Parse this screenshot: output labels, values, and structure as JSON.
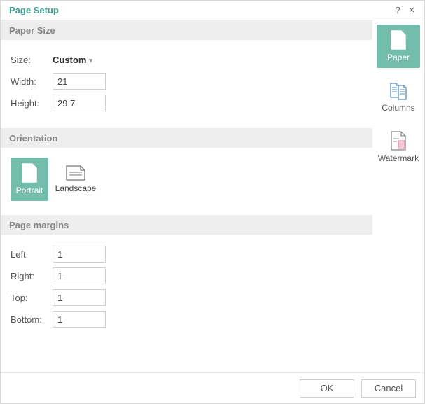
{
  "dialog": {
    "title": "Page Setup",
    "help_glyph": "?",
    "close_glyph": "✕"
  },
  "sections": {
    "paper_size": {
      "header": "Paper Size",
      "size_label": "Size:",
      "size_value": "Custom",
      "width_label": "Width:",
      "width_value": "21",
      "height_label": "Height:",
      "height_value": "29.7"
    },
    "orientation": {
      "header": "Orientation",
      "portrait_label": "Portrait",
      "landscape_label": "Landscape"
    },
    "margins": {
      "header": "Page margins",
      "left_label": "Left:",
      "left_value": "1",
      "right_label": "Right:",
      "right_value": "1",
      "top_label": "Top:",
      "top_value": "1",
      "bottom_label": "Bottom:",
      "bottom_value": "1"
    }
  },
  "sidebar": {
    "paper_label": "Paper",
    "columns_label": "Columns",
    "watermark_label": "Watermark"
  },
  "footer": {
    "ok_label": "OK",
    "cancel_label": "Cancel"
  }
}
